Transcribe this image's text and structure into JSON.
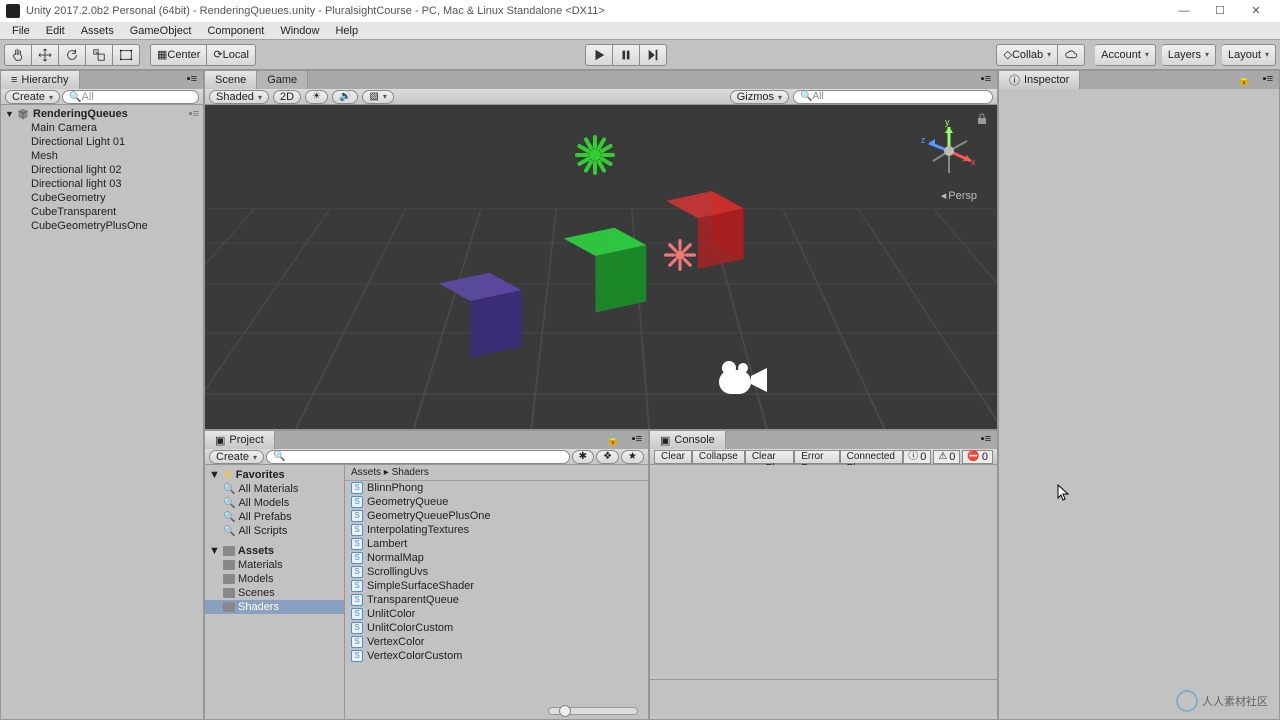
{
  "title": "Unity 2017.2.0b2 Personal (64bit) - RenderingQueues.unity - PluralsightCourse - PC, Mac & Linux Standalone <DX11>",
  "menu": [
    "File",
    "Edit",
    "Assets",
    "GameObject",
    "Component",
    "Window",
    "Help"
  ],
  "toolbar": {
    "center": "Center",
    "local": "Local",
    "collab": "Collab",
    "account": "Account",
    "layers": "Layers",
    "layout": "Layout"
  },
  "hierarchy": {
    "tab": "Hierarchy",
    "create": "Create",
    "searchPlaceholder": "All",
    "scene": "RenderingQueues",
    "items": [
      "Main Camera",
      "Directional Light 01",
      "Mesh",
      "Directional light 02",
      "Directional light 03",
      "CubeGeometry",
      "CubeTransparent",
      "CubeGeometryPlusOne"
    ]
  },
  "sceneTabs": {
    "scene": "Scene",
    "game": "Game"
  },
  "sceneBar": {
    "shaded": "Shaded",
    "twoD": "2D",
    "gizmos": "Gizmos",
    "perspLabel": "Persp"
  },
  "inspector": {
    "tab": "Inspector"
  },
  "project": {
    "tab": "Project",
    "create": "Create",
    "favorites": "Favorites",
    "favItems": [
      "All Materials",
      "All Models",
      "All Prefabs",
      "All Scripts"
    ],
    "assets": "Assets",
    "folders": [
      "Materials",
      "Models",
      "Scenes",
      "Shaders"
    ],
    "selectedFolder": "Shaders",
    "breadcrumb": "Assets  ▸  Shaders",
    "files": [
      "BlinnPhong",
      "GeometryQueue",
      "GeometryQueuePlusOne",
      "InterpolatingTextures",
      "Lambert",
      "NormalMap",
      "ScrollingUvs",
      "SimpleSurfaceShader",
      "TransparentQueue",
      "UnlitColor",
      "UnlitColorCustom",
      "VertexColor",
      "VertexColorCustom"
    ]
  },
  "console": {
    "tab": "Console",
    "buttons": [
      "Clear",
      "Collapse",
      "Clear on Play",
      "Error Pause",
      "Connected Playe"
    ],
    "counts": {
      "info": "0",
      "warn": "0",
      "err": "0"
    }
  },
  "watermark": "人人素材社区"
}
